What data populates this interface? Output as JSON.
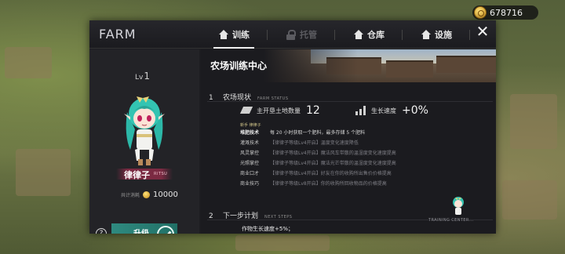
{
  "currency": {
    "amount": "678716",
    "icon": "gold-coin-icon"
  },
  "header": {
    "app_title": "FARM",
    "tabs": [
      {
        "label": "训练",
        "icon": "house-icon",
        "state": "active"
      },
      {
        "label": "托管",
        "icon": "lock-icon",
        "state": "disabled"
      },
      {
        "label": "仓库",
        "icon": "warehouse-icon",
        "state": "normal"
      },
      {
        "label": "设施",
        "icon": "facility-icon",
        "state": "normal"
      }
    ],
    "close_icon": "close-icon"
  },
  "character": {
    "level_prefix": "Lv",
    "level": "1",
    "name": "律律子",
    "name_en": "RITSU",
    "cost_label": "共计消耗",
    "cost_value": "10000",
    "upgrade_label": "升级",
    "help_label": "?"
  },
  "main": {
    "title": "农场训练中心",
    "status_section": {
      "number": "1",
      "title": "农场现状",
      "title_en": "FARM STATUS",
      "land_label": "主开垦土地数量",
      "land_value": "12",
      "growth_label": "生长速度",
      "growth_value": "+0%"
    },
    "new_tag": "新手 律律子",
    "skills": [
      {
        "name": "堆肥技术",
        "desc": "每 20 小时获取一个肥料，最多存储 5 个肥料",
        "active": true
      },
      {
        "name": "灌溉技术",
        "desc": "【律律子等级Lv4开启】温度变化速度降低",
        "active": false
      },
      {
        "name": "风灵掌控",
        "desc": "【律律子等级Lv4开启】魔法风车带散的温湿度变化速度提高",
        "active": false
      },
      {
        "name": "光照掌控",
        "desc": "【律律子等级Lv4开启】魔法光芒带散的温湿度变化速度提高",
        "active": false
      },
      {
        "name": "商业口才",
        "desc": "【律律子等级Lv4开启】好友在你的收购所出售价价格提高",
        "active": false
      },
      {
        "name": "商业技巧",
        "desc": "【律律子等级Lv8开启】你的收购所回收物品的价格提高",
        "active": false
      }
    ],
    "next_section": {
      "number": "2",
      "title": "下一步计划",
      "title_en": "NEXT STEPS",
      "plan_text": "作物生长速度+5%；"
    },
    "footer_text": "TRAINING CENTER..."
  }
}
